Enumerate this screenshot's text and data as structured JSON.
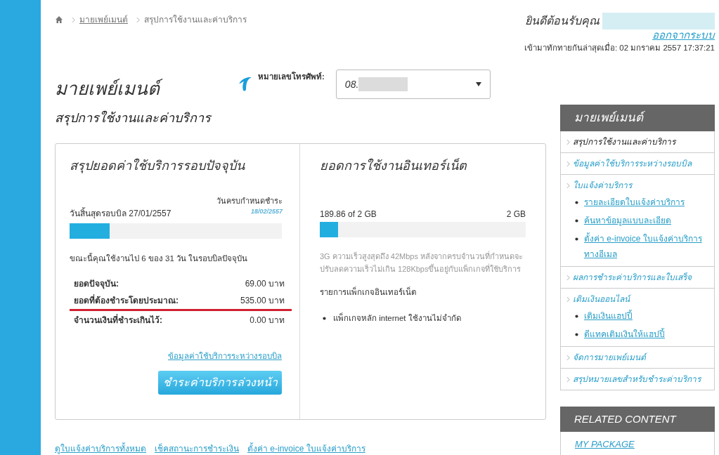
{
  "breadcrumb": {
    "items": [
      {
        "label": "มายเพย์เมนต์",
        "link": true
      },
      {
        "label": "สรุปการใช้งานและค่าบริการ",
        "link": false
      }
    ]
  },
  "header": {
    "welcome": "ยินดีต้อนรับคุณ",
    "logout": "ออกจากระบบ",
    "last_login": "เข้ามาทักทายกันล่าสุดเมื่อ: 02 มกราคม 2557 17:37:21"
  },
  "page_title": "มายเพย์เมนต์",
  "page_subtitle": "สรุปการใช้งานและค่าบริการ",
  "phone": {
    "label": "หมายเลขโทรศัพท์:",
    "value": "08."
  },
  "bill_panel": {
    "title": "สรุปยอดค่าใช้บริการรอบปัจจุบัน",
    "due_label": "วันครบกำหนดชำระ",
    "due_date": "18/02/2557",
    "cycle_end": "วันสิ้นสุดรอบบิล 27/01/2557",
    "level": 0.19,
    "usage_note": "ขณะนี้คุณใช้งานไป 6 ของ 31 วัน ในรอบบิลปัจจุบัน",
    "rows": [
      {
        "label": "ยอดปัจจุบัน:",
        "value": "69.00 บาท",
        "highlighted": false
      },
      {
        "label": "ยอดที่ต้องชำระโดยประมาณ:",
        "value": "535.00 บาท",
        "highlighted": true
      },
      {
        "label": "จำนวนเงินที่ชำระเกินไว้:",
        "value": "0.00 บาท",
        "highlighted": false
      }
    ],
    "link": "ข้อมูลค่าใช้บริการระหว่างรอบบิล",
    "button": "ชำระค่าบริการล่วงหน้า"
  },
  "internet_panel": {
    "title": "ยอดการใช้งานอินเทอร์เน็ต",
    "used": "189.86 of 2 GB",
    "total": "2 GB",
    "level": 0.09,
    "note": "3G ความเร็วสูงสุดถึง 42Mbps หลังจากครบจำนวนที่กำหนดจะปรับลดความเร็วไม่เกิน 128Kbpsขึ้นอยู่กับแพ็กเกจที่ใช้บริการ",
    "packages_title": "รายการแพ็กเกจอินเทอร์เน็ต",
    "packages": [
      "แพ็กเกจหลัก internet ใช้งานไม่จำกัด"
    ]
  },
  "footer_links": [
    "ดูใบแจ้งค่าบริการทั้งหมด",
    "เช็คสถานะการชำระเงิน",
    "ตั้งค่า e-invoice ใบแจ้งค่าบริการ"
  ],
  "sidebar": {
    "title": "มายเพย์เมนต์",
    "items": [
      {
        "label": "สรุปการใช้งานและค่าบริการ",
        "selected": true
      },
      {
        "label": "ข้อมูลค่าใช้บริการระหว่างรอบบิล",
        "selected": false
      },
      {
        "label": "ใบแจ้งค่าบริการ",
        "selected": false,
        "children": [
          "รายละเอียดใบแจ้งค่าบริการ",
          "ค้นหาข้อมูลแบบละเอียด",
          "ตั้งค่า e-invoice ใบแจ้งค่าบริการทางอีเมล"
        ]
      },
      {
        "label": "ผลการชำระค่าบริการและใบเสร็จ",
        "selected": false
      },
      {
        "label": "เติมเงินออนไลน์",
        "selected": false,
        "children": [
          "เติมเงินแฮปปี้",
          "ดีแทคเติมเงินให้แฮปปี้"
        ]
      },
      {
        "label": "จัดการมายเพย์เมนต์",
        "selected": false
      },
      {
        "label": "สรุปหมายเลขสำหรับชำระค่าบริการ",
        "selected": false
      }
    ]
  },
  "related": {
    "title": "RELATED CONTENT",
    "links": [
      "MY PACKAGE"
    ]
  }
}
